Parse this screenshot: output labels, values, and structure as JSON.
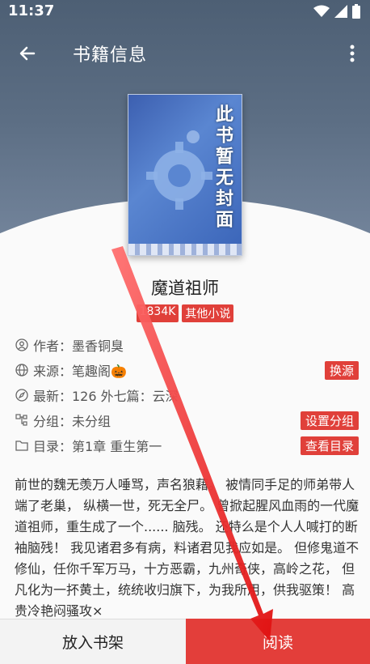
{
  "status_bar": {
    "time": "11:37"
  },
  "appbar": {
    "title": "书籍信息"
  },
  "cover": {
    "placeholder_text": "此书暂无封面"
  },
  "book": {
    "title": "魔道祖师",
    "tags": [
      "1834K",
      "其他小说"
    ]
  },
  "info": {
    "author": "作者：墨香铜臭",
    "source": "来源：笔趣阁🎃",
    "latest": "最新：126 外七篇：云深",
    "group": "分组：未分组",
    "toc": "目录：第1章 重生第一",
    "change_source_btn": "换源",
    "set_group_btn": "设置分组",
    "view_toc_btn": "查看目录"
  },
  "intro": "前世的魏无羡万人唾骂，声名狼藉。 被情同手足的师弟带人端了老巢， 纵横一世，死无全尸。 曾掀起腥风血雨的一代魔道祖师，重生成了一个...... 脑残。 还特么是个人人喊打的断袖脑残！ 我见诸君多有病，料诸君见我应如是。 但修鬼道不修仙，任你千军万马，十方恶霸，九州奇侠，高岭之花， 但凡化为一抔黄土，统统收归旗下，为我所用，供我驱策！ 高贵冷艳闷骚攻×",
  "bottom": {
    "shelf_btn": "放入书架",
    "read_btn": "阅读"
  },
  "colors": {
    "accent": "#e33e3a",
    "header": "#5c6e84"
  }
}
